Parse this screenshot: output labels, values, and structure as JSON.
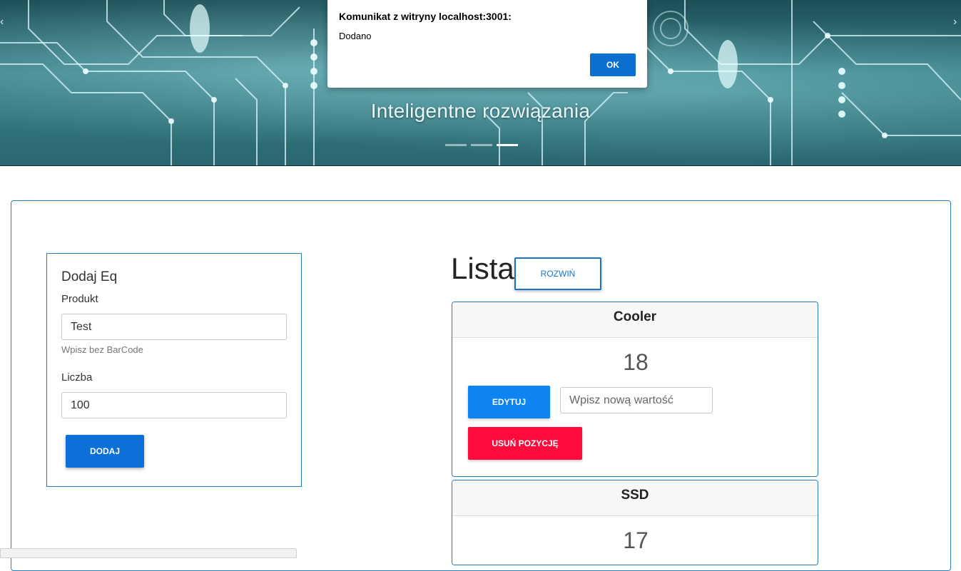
{
  "carousel": {
    "caption": "Inteligentne rozwiązania",
    "slide_count": 3,
    "active_slide": 3
  },
  "alert": {
    "title": "Komunikat z witryny localhost:3001:",
    "message": "Dodano",
    "ok_label": "OK"
  },
  "add_form": {
    "title": "Dodaj Eq",
    "product_label": "Produkt",
    "product_value": "Test",
    "product_hint": "Wpisz bez BarCode",
    "count_label": "Liczba",
    "count_value": "100",
    "add_label": "DODAJ"
  },
  "list": {
    "title": "Lista",
    "expand_label": "ROZWIŃ",
    "items": [
      {
        "name": "Cooler",
        "value": "18",
        "edit_label": "EDYTUJ",
        "new_value_placeholder": "Wpisz nową wartość",
        "delete_label": "USUŃ POZYCJĘ"
      },
      {
        "name": "SSD",
        "value": "17"
      }
    ]
  },
  "colors": {
    "primary_blue": "#0d6fd8",
    "edit_blue": "#0d84f0",
    "delete_red": "#ff0a3c",
    "border_blue": "#2b7fb8"
  }
}
